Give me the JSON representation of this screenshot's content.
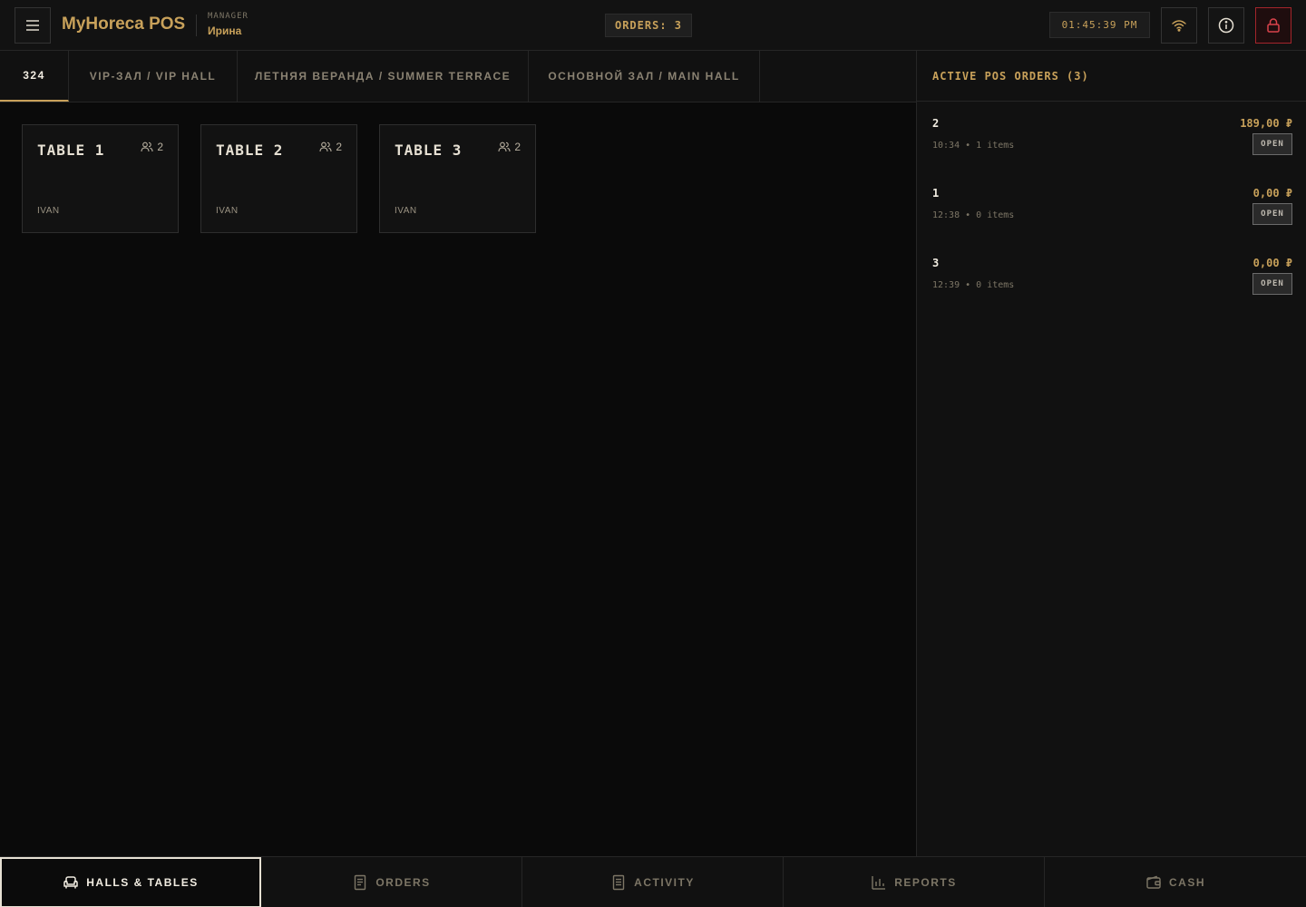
{
  "header": {
    "brand": "MyHoreca POS",
    "role_label": "MANAGER",
    "user_name": "Ирина",
    "orders_badge": "ORDERS: 3",
    "clock": "01:45:39 PM",
    "icons": {
      "menu": "hamburger-icon",
      "wifi": "wifi-icon",
      "info": "info-icon",
      "lock": "lock-icon"
    }
  },
  "halls": {
    "tabs": [
      {
        "label": "324",
        "active": true
      },
      {
        "label": "VIP-ЗАЛ / VIP HALL"
      },
      {
        "label": "ЛЕТНЯЯ ВЕРАНДА / SUMMER TERRACE"
      },
      {
        "label": "ОСНОВНОЙ ЗАЛ / MAIN HALL"
      }
    ]
  },
  "tables": [
    {
      "name": "TABLE 1",
      "seats": "2",
      "waiter": "IVAN"
    },
    {
      "name": "TABLE 2",
      "seats": "2",
      "waiter": "IVAN"
    },
    {
      "name": "TABLE 3",
      "seats": "2",
      "waiter": "IVAN"
    }
  ],
  "side_panel": {
    "title": "ACTIVE POS ORDERS (3)",
    "orders": [
      {
        "number": "2",
        "total": "189,00 ₽",
        "meta": "10:34 • 1 items",
        "status": "OPEN"
      },
      {
        "number": "1",
        "total": "0,00 ₽",
        "meta": "12:38 • 0 items",
        "status": "OPEN"
      },
      {
        "number": "3",
        "total": "0,00 ₽",
        "meta": "12:39 • 0 items",
        "status": "OPEN"
      }
    ]
  },
  "bottom_nav": [
    {
      "label": "HALLS & TABLES",
      "icon": "armchair-icon",
      "active": true
    },
    {
      "label": "ORDERS",
      "icon": "receipt-icon"
    },
    {
      "label": "ACTIVITY",
      "icon": "document-icon"
    },
    {
      "label": "REPORTS",
      "icon": "bar-chart-icon"
    },
    {
      "label": "CASH",
      "icon": "wallet-icon"
    }
  ],
  "colors": {
    "accent": "#c8a15a",
    "background": "#0a0a0a",
    "panel": "#111111",
    "danger": "#a3252b"
  }
}
